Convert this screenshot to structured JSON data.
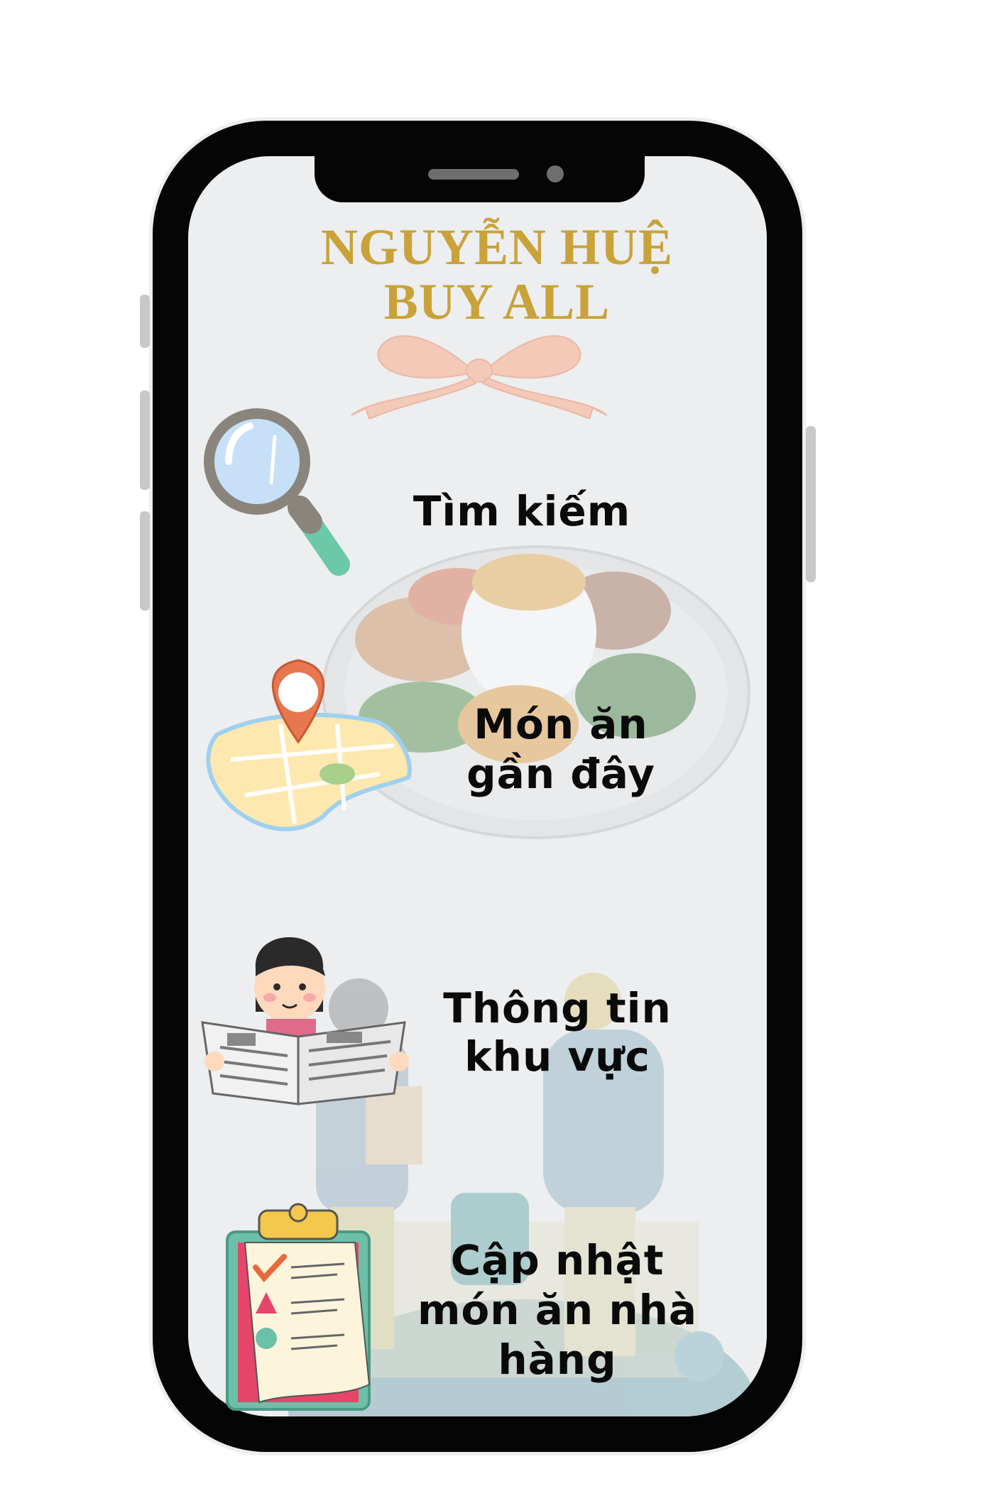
{
  "app": {
    "title_line1": "NGUYỄN HUỆ",
    "title_line2": "BUY ALL"
  },
  "menu": {
    "items": [
      {
        "label": "Tìm kiếm",
        "icon": "magnifier-icon"
      },
      {
        "label": "Món ăn gần đây",
        "line1": "Món ăn",
        "line2": "gần đây",
        "icon": "map-pin-icon"
      },
      {
        "label": "Thông tin khu vực",
        "line1": "Thông tin",
        "line2": "khu vực",
        "icon": "newspaper-reader-icon"
      },
      {
        "label": "Cập nhật món ăn nhà hàng",
        "line1": "Cập nhật",
        "line2": "món ăn nhà",
        "line3": "hàng",
        "icon": "clipboard-checklist-icon"
      }
    ]
  },
  "colors": {
    "title": "#c9a23a",
    "screen_bg": "#eceef0",
    "frame": "#050505",
    "ribbon": "#f3c9b8"
  }
}
